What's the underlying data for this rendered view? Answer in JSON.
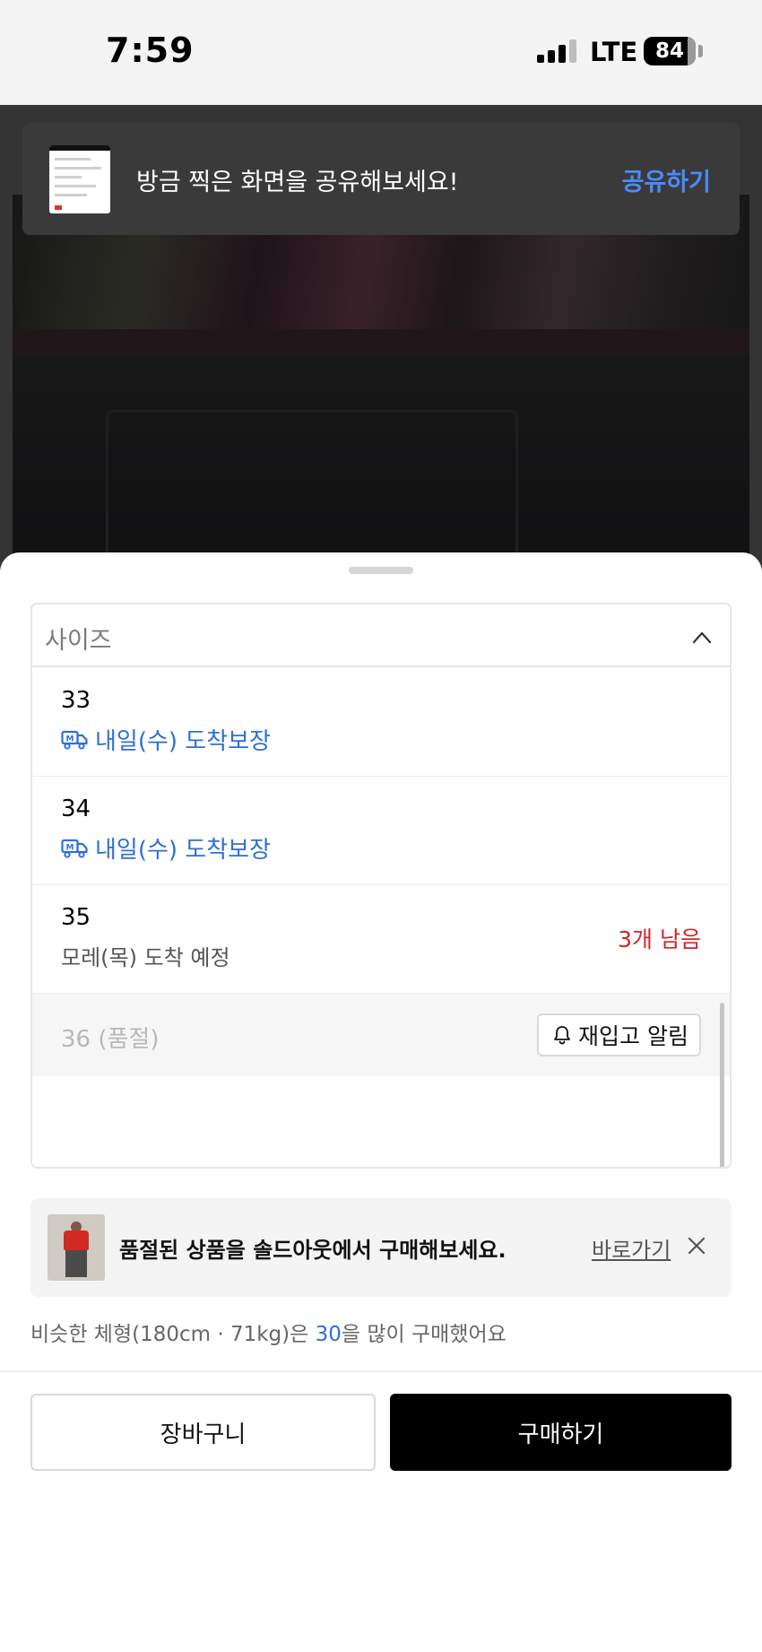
{
  "status_bar": {
    "time": "7:59",
    "network": "LTE",
    "battery": "84",
    "battery_level": 0.84
  },
  "share_toast": {
    "message": "방금 찍은 화면을 공유해보세요!",
    "action": "공유하기"
  },
  "size_selector": {
    "label": "사이즈",
    "options": [
      {
        "size": "33",
        "delivery": "내일(수) 도착보장"
      },
      {
        "size": "34",
        "delivery": "내일(수) 도착보장"
      },
      {
        "size": "35",
        "eta": "모레(목) 도착 예정",
        "stock": "3개 남음"
      },
      {
        "size": "36 (품절)",
        "restock_button": "재입고 알림"
      }
    ]
  },
  "soldout_banner": {
    "text": "품절된 상품을 솔드아웃에서 구매해보세요.",
    "link": "바로가기"
  },
  "recommendation": {
    "prefix": "비슷한 체형(180cm · 71kg)은 ",
    "size": "30",
    "suffix": "을 많이 구매했어요"
  },
  "actions": {
    "cart": "장바구니",
    "buy": "구매하기"
  },
  "colors": {
    "accent_blue": "#2f6fd6",
    "share_blue": "#4a8bff",
    "stock_red": "#d0252b",
    "buy_black": "#000000"
  }
}
